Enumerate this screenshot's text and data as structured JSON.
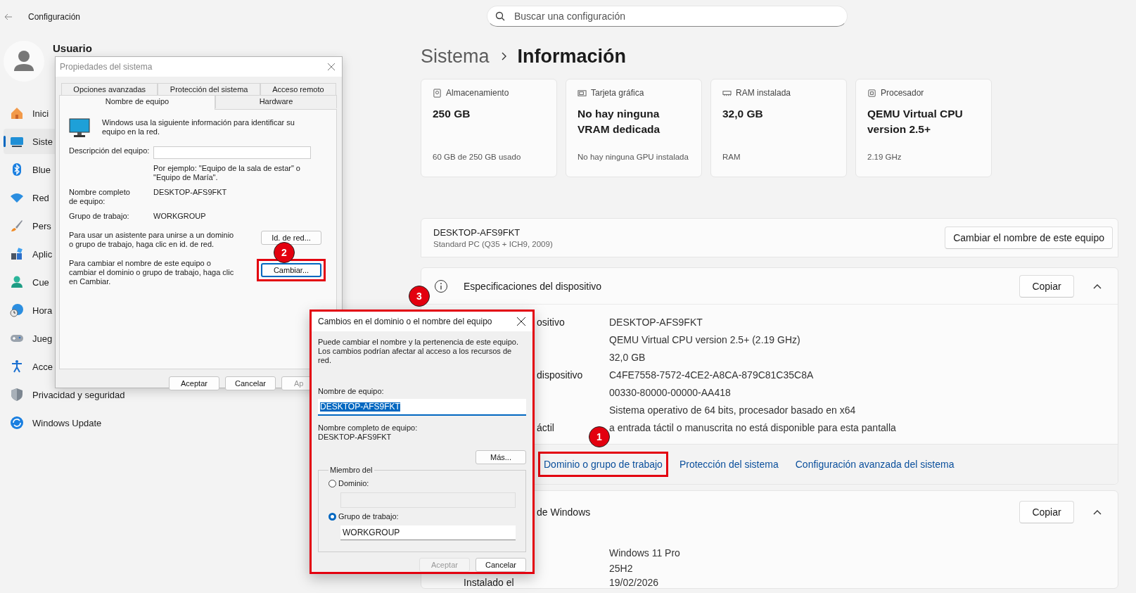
{
  "app": {
    "title": "Configuración"
  },
  "search": {
    "placeholder": "Buscar una configuración"
  },
  "user": {
    "name": "Usuario"
  },
  "sidebar": {
    "items": [
      {
        "label": "Inici",
        "selected": false
      },
      {
        "label": "Siste",
        "selected": true
      },
      {
        "label": "Blue",
        "selected": false
      },
      {
        "label": "Red",
        "selected": false
      },
      {
        "label": "Pers",
        "selected": false
      },
      {
        "label": "Aplic",
        "selected": false
      },
      {
        "label": "Cue",
        "selected": false
      },
      {
        "label": "Hora",
        "selected": false
      },
      {
        "label": "Jueg",
        "selected": false
      },
      {
        "label": "Acce",
        "selected": false
      },
      {
        "label": "Privacidad y seguridad",
        "selected": false
      },
      {
        "label": "Windows Update",
        "selected": false
      }
    ]
  },
  "breadcrumb": {
    "parent": "Sistema",
    "current": "Información"
  },
  "cards": [
    {
      "label": "Almacenamiento",
      "value": "250 GB",
      "detail": "60 GB de 250 GB usado"
    },
    {
      "label": "Tarjeta gráfica",
      "value": "No hay ninguna VRAM dedicada",
      "detail": "No hay ninguna GPU instalada"
    },
    {
      "label": "RAM instalada",
      "value": "32,0 GB",
      "detail": "RAM"
    },
    {
      "label": "Procesador",
      "value": "QEMU Virtual CPU version 2.5+",
      "detail": "2.19 GHz"
    }
  ],
  "device": {
    "name": "DESKTOP-AFS9FKT",
    "model": "Standard PC (Q35 + ICH9, 2009)",
    "rename_button": "Cambiar el nombre de este equipo"
  },
  "device_specs": {
    "title": "Especificaciones del dispositivo",
    "copy_button": "Copiar",
    "expanded": true,
    "rows": [
      {
        "label": "ositivo",
        "value": "DESKTOP-AFS9FKT"
      },
      {
        "value": "QEMU Virtual CPU version 2.5+ (2.19 GHz)"
      },
      {
        "value": "32,0 GB"
      },
      {
        "label": "dispositivo",
        "value": "C4FE7558-7572-4CE2-A8CA-879C81C35C8A"
      },
      {
        "value": "00330-80000-00000-AA418"
      },
      {
        "value": "Sistema operativo de 64 bits, procesador basado en x64"
      },
      {
        "label": "áctil",
        "value": "a entrada táctil o manuscrita no está disponible para esta pantalla"
      }
    ],
    "links": [
      {
        "label": "Dominio o grupo de trabajo",
        "highlighted": true
      },
      {
        "label": "Protección del sistema",
        "highlighted": false
      },
      {
        "label": "Configuración avanzada del sistema",
        "highlighted": false
      }
    ]
  },
  "windows_specs": {
    "title": "de Windows",
    "copy_button": "Copiar",
    "expanded": true,
    "rows": [
      {
        "value": "Windows 11 Pro"
      },
      {
        "value": "25H2"
      },
      {
        "label": "Instalado el",
        "value": "19/02/2026"
      }
    ]
  },
  "system_properties": {
    "title": "Propiedades del sistema",
    "active": false,
    "tab_rows": [
      [
        {
          "label": "Opciones avanzadas",
          "selected": false
        },
        {
          "label": "Protección del sistema",
          "selected": false
        },
        {
          "label": "Acceso remoto",
          "selected": false
        }
      ],
      [
        {
          "label": "Nombre de equipo",
          "selected": true
        },
        {
          "label": "Hardware",
          "selected": false
        }
      ]
    ],
    "intro": "Windows usa la siguiente información para identificar su equipo en la red.",
    "description_label": "Descripción del equipo:",
    "example": "Por ejemplo: \"Equipo de la sala de estar\" o \"Equipo de María\".",
    "full_name_label": "Nombre completo de equipo:",
    "full_name": "DESKTOP-AFS9FKT",
    "workgroup_label": "Grupo de trabajo:",
    "workgroup": "WORKGROUP",
    "wizard_text": "Para usar un asistente para unirse a un dominio o grupo de trabajo, haga clic en id. de red.",
    "wizard_button": "Id. de red...",
    "change_text": "Para cambiar el nombre de este equipo o cambiar el dominio o grupo de trabajo, haga clic en Cambiar.",
    "change_button": {
      "label": "Cambiar...",
      "highlighted": true
    },
    "buttons": [
      {
        "label": "Aceptar"
      },
      {
        "label": "Cancelar"
      },
      {
        "label": "Ap"
      }
    ]
  },
  "change_dialog": {
    "title": "Cambios en el dominio o el nombre del equipo",
    "highlighted": true,
    "intro": "Puede cambiar el nombre y la pertenencia de este equipo. Los cambios podrían afectar al acceso a los recursos de red.",
    "name_label": "Nombre de equipo:",
    "name_value": "DESKTOP-AFS9FKT",
    "name_selected": true,
    "full_name_label": "Nombre completo de equipo:",
    "full_name": "DESKTOP-AFS9FKT",
    "more_button": "Más...",
    "member_legend": "Miembro del",
    "options": [
      {
        "label": "Dominio:",
        "selected": false
      },
      {
        "label": "Grupo de trabajo:",
        "selected": true,
        "value": "WORKGROUP"
      }
    ],
    "buttons": [
      {
        "label": "Aceptar",
        "disabled": true
      },
      {
        "label": "Cancelar",
        "disabled": false
      }
    ]
  },
  "callouts": [
    {
      "number": "1"
    },
    {
      "number": "2"
    },
    {
      "number": "3"
    }
  ]
}
